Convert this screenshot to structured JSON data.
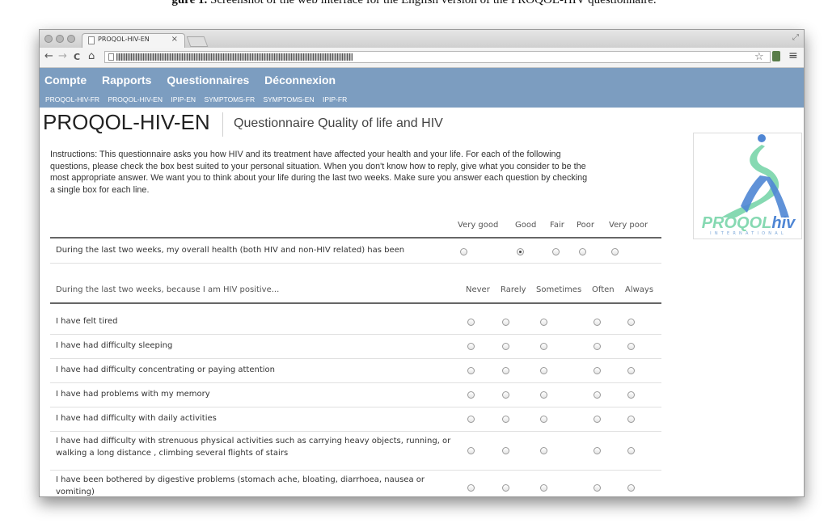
{
  "caption": {
    "label": "gure 1.",
    "text": "Screenshot of the web interface for the English version of the PROQOL-HIV questionnaire."
  },
  "browser": {
    "tab_title": "PROQOL-HIV-EN",
    "tab_close": "×",
    "nav": {
      "back": "←",
      "forward": "→",
      "reload": "C",
      "home": "⌂"
    },
    "icons": [
      "doc-icon",
      "star-icon",
      "extension-icon",
      "menu-icon"
    ],
    "star": "☆",
    "menu": "≡",
    "resize": "⤢"
  },
  "site": {
    "main_nav": [
      "Compte",
      "Rapports",
      "Questionnaires",
      "Déconnexion"
    ],
    "sub_nav": [
      "PROQOL-HIV-FR",
      "PROQOL-HIV-EN",
      "IPIP-EN",
      "SYMPTOMS-FR",
      "SYMPTOMS-EN",
      "IPIP-FR"
    ],
    "title": "PROQOL-HIV-EN",
    "subtitle": "Questionnaire Quality of life and HIV",
    "instructions": "Instructions: This questionnaire asks you how HIV and its treatment have affected your health and your life. For each of the following questions, please check the box best suited to your personal situation. When you don't know how to reply, give what you consider to be the most appropriate answer. We want you to think about your life during the last two weeks. Make sure you answer each question by checking a single box for each line.",
    "logo": {
      "part1": "PROQOL",
      "part2": "hiv",
      "sub": "INTERNATIONAL"
    }
  },
  "survey": {
    "section1": {
      "options": [
        "Very good",
        "Good",
        "Fair",
        "Poor",
        "Very poor"
      ],
      "question": "During the last two weeks, my overall health (both HIV and non-HIV related) has been",
      "selected": 1
    },
    "section2": {
      "header": "During the last two weeks, because I am HIV positive...",
      "options": [
        "Never",
        "Rarely",
        "Sometimes",
        "Often",
        "Always"
      ],
      "questions": [
        "I have felt tired",
        "I have had difficulty sleeping",
        "I have had difficulty concentrating or paying attention",
        "I have had problems with my memory",
        "I have had difficulty with daily activities",
        "I have had difficulty with strenuous physical activities such as carrying heavy objects, running, or walking a long distance , climbing several flights of stairs",
        "I have been bothered by digestive problems (stomach ache, bloating, diarrhoea, nausea or vomiting)"
      ]
    }
  }
}
